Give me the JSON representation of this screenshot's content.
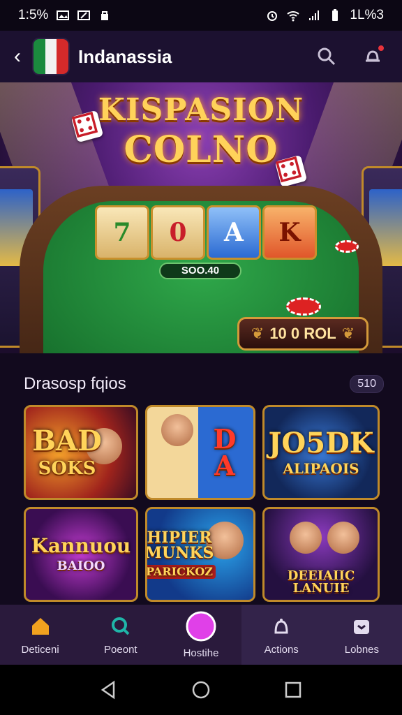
{
  "status_bar": {
    "time": "1:5%",
    "battery_text": "1L%3"
  },
  "app_bar": {
    "title": "Indanassia"
  },
  "banner": {
    "title_line1": "KISPASION",
    "title_line2": "COLNO",
    "reels": [
      "",
      "7\n0",
      "A",
      "K"
    ],
    "pot_value": "SOO.40",
    "bonus_label": "10 0 ROL"
  },
  "section": {
    "title": "Drasosp fqios",
    "count": "510"
  },
  "games": [
    {
      "title": "BAD",
      "subtitle": "SOKS"
    },
    {
      "title": "D\nA",
      "subtitle": ""
    },
    {
      "title": "JO5DK",
      "subtitle": "ALIPAOIS"
    },
    {
      "title": "Kannuou",
      "subtitle": "BAIOO"
    },
    {
      "title": "HIPIER MUNKS",
      "subtitle": "PARICKOZ"
    },
    {
      "title": "DEEIAIIC",
      "subtitle": "LANUIE"
    }
  ],
  "bottom_nav": [
    {
      "label": "Deticeni",
      "icon": "home-icon"
    },
    {
      "label": "Poeont",
      "icon": "search-icon"
    },
    {
      "label": "Hostihe",
      "icon": "circle-icon"
    },
    {
      "label": "Actions",
      "icon": "bell-icon"
    },
    {
      "label": "Lobnes",
      "icon": "gift-icon"
    }
  ],
  "colors": {
    "accent_gold": "#c08a2a",
    "home_orange": "#f1a11f",
    "search_teal": "#1fb5a8",
    "center_magenta": "#e040e8"
  }
}
